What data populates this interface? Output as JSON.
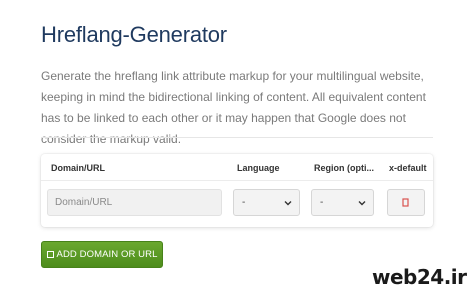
{
  "header": {
    "title": "Hreflang-Generator",
    "description": "Generate the hreflang link attribute markup for your multilingual website, keeping in mind the bidirectional linking of content. All equivalent content has to be linked to each other or it may happen that Google does not consider the markup valid."
  },
  "table": {
    "columns": {
      "domain": "Domain/URL",
      "language": "Language",
      "region": "Region (opti...",
      "xdefault": "x-default"
    },
    "row": {
      "domain_placeholder": "Domain/URL",
      "language_value": "-",
      "region_value": "-",
      "xdefault_checked": false
    }
  },
  "actions": {
    "add_label": "ADD DOMAIN OR URL"
  },
  "watermark": {
    "text": "web24.ir"
  },
  "colors": {
    "title": "#1f3a5f",
    "button_green": "#5a9a25",
    "checkbox_red": "#d9534f"
  },
  "icons": {
    "add": "square-outline-icon",
    "select": "chevron-down-icon",
    "checkbox": "checkbox-icon"
  }
}
